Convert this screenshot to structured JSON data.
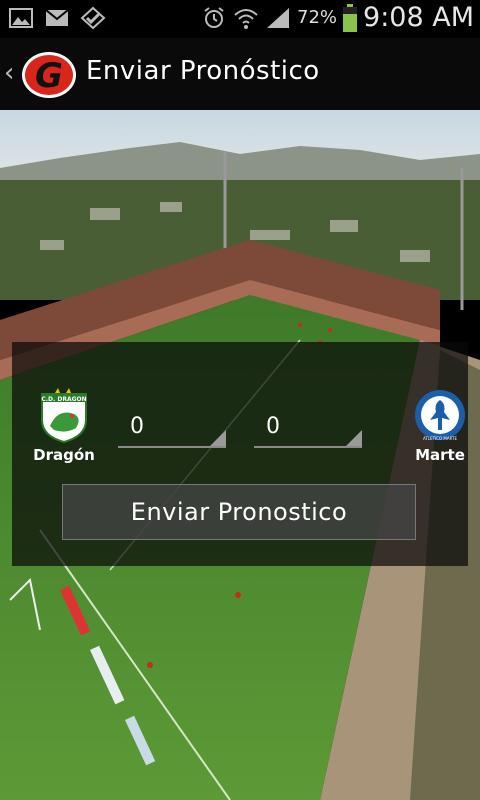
{
  "status_bar": {
    "battery": "72%",
    "time": "9:08 AM",
    "icons": [
      "image-icon",
      "gmail-icon",
      "check-icon",
      "alarm-icon",
      "wifi-icon",
      "signal-icon",
      "battery-icon"
    ]
  },
  "header": {
    "title": "Enviar Pronóstico",
    "logo": "G"
  },
  "match": {
    "home_team": "Dragón",
    "home_crest_text": "C.D. DRAGON",
    "away_team": "Marte",
    "away_crest_text": "ATLETICO MARTE",
    "home_score": "0",
    "away_score": "0"
  },
  "actions": {
    "send_label": "Enviar Pronostico"
  },
  "colors": {
    "logo_red": "#d8261d",
    "grass": "#4e8a2e",
    "sky": "#cfdde6"
  }
}
